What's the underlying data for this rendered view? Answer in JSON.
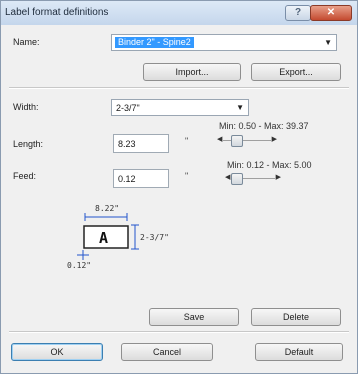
{
  "window": {
    "title": "Label format definitions",
    "help_glyph": "?",
    "close_glyph": "✕"
  },
  "name": {
    "label": "Name:",
    "value": "Binder 2\" - Spine2"
  },
  "buttons": {
    "import": "Import...",
    "export": "Export...",
    "save": "Save",
    "delete": "Delete",
    "ok": "OK",
    "cancel": "Cancel",
    "default": "Default"
  },
  "width": {
    "label": "Width:",
    "value": "2-3/7\""
  },
  "length": {
    "label": "Length:",
    "value": "8.23",
    "unit": "\"",
    "range": "Min: 0.50 - Max: 39.37",
    "slider_fraction": 0.2
  },
  "feed": {
    "label": "Feed:",
    "value": "0.12",
    "unit": "\"",
    "range": "Min: 0.12 - Max: 5.00",
    "slider_fraction": 0.0
  },
  "preview": {
    "length_text": "8.22\"",
    "letter": "A",
    "width_text": "2-3/7\"",
    "feed_text": "0.12\""
  },
  "icons": {
    "combo_arrow": "▼",
    "slider_left": "◀",
    "slider_right": "▶"
  },
  "colors": {
    "title_gradient_top": "#dde9f6",
    "selection": "#3399ff",
    "close_red": "#c44a30",
    "preview_blue": "#2255cc"
  }
}
